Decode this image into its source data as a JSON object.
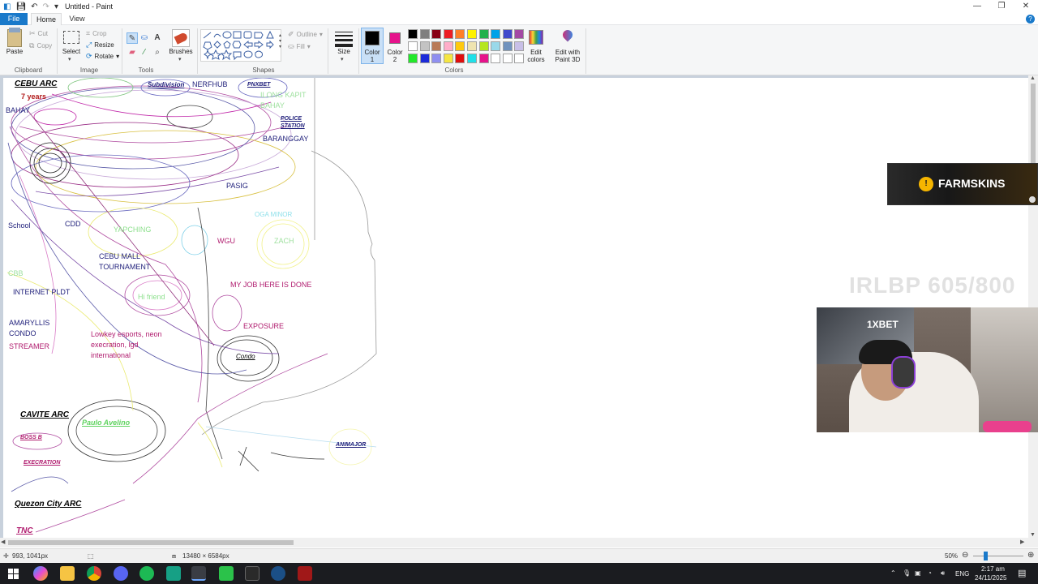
{
  "app": {
    "title": "Untitled - Paint"
  },
  "menu": {
    "file": "File",
    "home": "Home",
    "view": "View",
    "help": "?"
  },
  "ribbon": {
    "clipboard": {
      "paste": "Paste",
      "cut": "Cut",
      "copy": "Copy",
      "label": "Clipboard"
    },
    "image": {
      "select": "Select",
      "crop": "Crop",
      "resize": "Resize",
      "rotate": "Rotate",
      "label": "Image"
    },
    "tools": {
      "label": "Tools"
    },
    "brushes": {
      "label": "Brushes"
    },
    "shapes": {
      "outline": "Outline",
      "fill": "Fill",
      "label": "Shapes"
    },
    "size": {
      "label": "Size"
    },
    "colors": {
      "color1_l1": "Color",
      "color1_l2": "1",
      "color2_l1": "Color",
      "color2_l2": "2",
      "edit_l1": "Edit",
      "edit_l2": "colors",
      "paint3d_l1": "Edit with",
      "paint3d_l2": "Paint 3D",
      "label": "Colors",
      "color1": "#000000",
      "color2": "#e6138b",
      "palette_row1": [
        "#000000",
        "#7f7f7f",
        "#880015",
        "#ed1c24",
        "#ff7f27",
        "#fff200",
        "#22b14c",
        "#00a2e8",
        "#3f48cc",
        "#a349a4"
      ],
      "palette_row2": [
        "#ffffff",
        "#c3c3c3",
        "#b97a57",
        "#ffaec9",
        "#ffc90e",
        "#efe4b0",
        "#b5e61d",
        "#99d9ea",
        "#7092be",
        "#c8bfe7"
      ],
      "palette_row3": [
        "#22e82a",
        "#1c2bd9",
        "#8f8ff0",
        "#f5e642",
        "#e00d0d",
        "#1fe0e8",
        "#e6138b",
        "#ffffff",
        "#ffffff",
        "#ffffff"
      ]
    }
  },
  "canvas_labels": {
    "cebu_arc": "CEBU ARC",
    "seven_years": "7 years",
    "bahay": "BAHAY",
    "subdivision": "Subdivision",
    "nerfhub": "NERFHUB",
    "pnxbet": "PNXBET",
    "ilong_kapit": "ILONG KAPIT",
    "bahay2": "BAHAY",
    "police": "POLICE",
    "station": "STATION",
    "baranggay": "BARANGGAY",
    "pasig": "PASIG",
    "school": "School",
    "cdd": "CDD",
    "yapching": "YAPCHING",
    "oga_minor": "OGA MINOR",
    "wgu": "WGU",
    "zach": "ZACH",
    "cebu_mall": "CEBU MALL",
    "tournament": "TOURNAMENT",
    "cbb": "CBB",
    "internet": "INTERNET PLDT",
    "hi_friend": "Hi friend",
    "my_job": "MY JOB HERE IS DONE",
    "amaryllis": "AMARYLLIS",
    "condo": "CONDO",
    "streamer": "STREAMER",
    "lowkey1": "Lowkey esports, neon",
    "lowkey2": "execration, lgd",
    "lowkey3": "international",
    "exposure": "EXPOSURE",
    "condo2": "Condo",
    "cavite_arc": "CAVITE ARC",
    "paulo": "Paulo Avelino",
    "boss_b": "BOSS B",
    "execration": "EXECRATION",
    "animajor": "ANIMAJOR",
    "quezon": "Quezon City ARC",
    "tnc": "TNC"
  },
  "overlays": {
    "ad_text": "FARMSKINS",
    "counter": "IRLBP 605/800",
    "webcam_sign": "1XBET"
  },
  "status": {
    "cursor": "993, 1041px",
    "size": "13480 × 6584px",
    "zoom": "50%"
  },
  "taskbar": {
    "lang": "ENG",
    "time": "2:17 am",
    "date": "24/11/2025"
  }
}
